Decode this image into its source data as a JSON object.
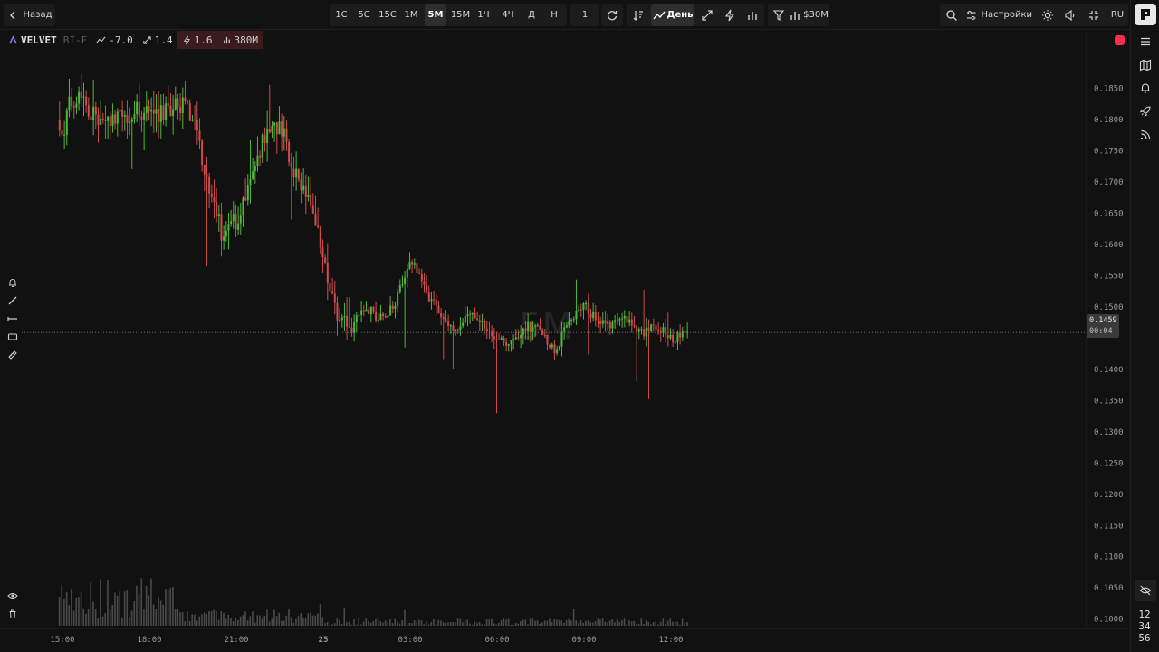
{
  "topbar": {
    "back_label": "Назад",
    "timeframes": [
      "1С",
      "5С",
      "15С",
      "1М",
      "5М",
      "15М",
      "1Ч",
      "4Ч",
      "Д",
      "Н"
    ],
    "active_timeframe": "5М",
    "multiplier": "1",
    "period_label": "День",
    "filter_label": "$30M",
    "settings_label": "Настройки",
    "language": "RU"
  },
  "infobar": {
    "symbol": "VELVET",
    "exchange": "BI-F",
    "change": "-7.0",
    "stat1": "1.4",
    "stat2": "1.6",
    "volume": "380M"
  },
  "price_tag": {
    "price": "0.1459",
    "countdown": "00:04"
  },
  "clock": {
    "hours": "12",
    "minutes": "34",
    "seconds": "56"
  },
  "watermark": "5М",
  "colors": {
    "up": "#4fb83a",
    "down": "#d24b4b",
    "record": "#ff2d55",
    "background": "#111111"
  },
  "icons": {
    "back": "chevron-left-icon",
    "refresh": "refresh-icon",
    "sort": "sort-icon",
    "trend": "trend-up-icon",
    "expand": "expand-icon",
    "bolt": "bolt-icon",
    "bars": "bars-icon",
    "filter": "filter-icon",
    "search": "search-icon",
    "settings": "settings-icon",
    "theme": "sun-icon",
    "sound": "sound-icon",
    "fullscreen": "fullscreen-icon",
    "menu": "menu-icon",
    "map": "map-icon",
    "bell": "bell-icon",
    "rocket": "rocket-icon",
    "feed": "rss-icon",
    "hide": "eye-off-icon"
  },
  "chart_data": {
    "type": "candlestick",
    "y_ticks": [
      "0.1850",
      "0.1800",
      "0.1750",
      "0.1700",
      "0.1650",
      "0.1600",
      "0.1550",
      "0.1500",
      "0.1400",
      "0.1350",
      "0.1300",
      "0.1250",
      "0.1200",
      "0.1150",
      "0.1100",
      "0.1050",
      "0.1000"
    ],
    "x_ticks": [
      "15:00",
      "18:00",
      "21:00",
      "25",
      "03:00",
      "06:00",
      "09:00",
      "12:00"
    ],
    "x_tick_hours": [
      15,
      18,
      21,
      24,
      27,
      30,
      33,
      36
    ],
    "ylim": [
      0.0985,
      0.1925
    ],
    "current_price": 0.1459,
    "start_hour": 14.9,
    "end_hour": 36.6,
    "close_path": [
      [
        14.9,
        0.18
      ],
      [
        15.0,
        0.176
      ],
      [
        15.2,
        0.182
      ],
      [
        15.6,
        0.185
      ],
      [
        16.0,
        0.181
      ],
      [
        16.5,
        0.179
      ],
      [
        17.0,
        0.18
      ],
      [
        17.5,
        0.182
      ],
      [
        18.0,
        0.181
      ],
      [
        18.5,
        0.181
      ],
      [
        19.0,
        0.183
      ],
      [
        19.5,
        0.18
      ],
      [
        20.0,
        0.171
      ],
      [
        20.5,
        0.162
      ],
      [
        21.0,
        0.164
      ],
      [
        21.5,
        0.17
      ],
      [
        22.0,
        0.178
      ],
      [
        22.5,
        0.179
      ],
      [
        23.0,
        0.172
      ],
      [
        23.5,
        0.167
      ],
      [
        24.0,
        0.158
      ],
      [
        24.5,
        0.148
      ],
      [
        25.0,
        0.147
      ],
      [
        25.5,
        0.15
      ],
      [
        26.0,
        0.148
      ],
      [
        26.5,
        0.151
      ],
      [
        27.0,
        0.158
      ],
      [
        27.5,
        0.153
      ],
      [
        28.0,
        0.149
      ],
      [
        28.5,
        0.146
      ],
      [
        29.0,
        0.149
      ],
      [
        29.5,
        0.147
      ],
      [
        30.0,
        0.145
      ],
      [
        30.5,
        0.144
      ],
      [
        31.0,
        0.147
      ],
      [
        31.5,
        0.146
      ],
      [
        32.0,
        0.143
      ],
      [
        32.5,
        0.148
      ],
      [
        33.0,
        0.15
      ],
      [
        33.5,
        0.148
      ],
      [
        34.0,
        0.147
      ],
      [
        34.5,
        0.148
      ],
      [
        35.0,
        0.146
      ],
      [
        35.5,
        0.147
      ],
      [
        36.0,
        0.145
      ],
      [
        36.6,
        0.146
      ]
    ]
  }
}
